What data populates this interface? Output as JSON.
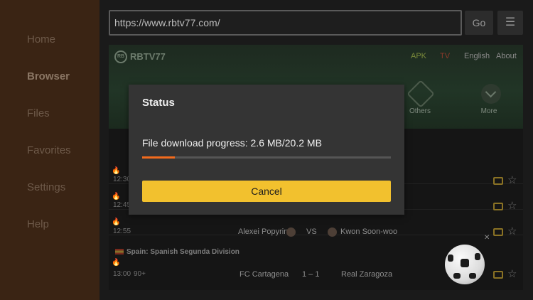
{
  "sidebar": {
    "items": [
      {
        "label": "Home",
        "active": false
      },
      {
        "label": "Browser",
        "active": true
      },
      {
        "label": "Files",
        "active": false
      },
      {
        "label": "Favorites",
        "active": false
      },
      {
        "label": "Settings",
        "active": false
      },
      {
        "label": "Help",
        "active": false
      }
    ]
  },
  "toolbar": {
    "url_value": "https://www.rbtv77.com/",
    "go_label": "Go",
    "menu_icon": "☰"
  },
  "website": {
    "logo_text": "RB",
    "title": "RBTV77",
    "top_links": {
      "apk": "APK",
      "tv": "TV",
      "language": "English",
      "about": "About"
    },
    "categories": [
      "Others",
      "More"
    ],
    "matches": [
      {
        "time": "12:30"
      },
      {
        "time": "12:45"
      },
      {
        "time": "12:55",
        "home": "Alexei Popyrin",
        "vs": "VS",
        "away": "Kwon Soon-woo"
      },
      {
        "league": "Spain: Spanish Segunda Division"
      },
      {
        "time": "13:00",
        "minute": "90+",
        "home": "FC Cartagena",
        "score": "1 – 1",
        "away": "Real Zaragoza"
      }
    ]
  },
  "dialog": {
    "title": "Status",
    "message": "File download progress: 2.6 MB/20.2 MB",
    "progress_fraction": 0.13,
    "cancel_label": "Cancel"
  },
  "colors": {
    "accent": "#f2c12e",
    "progress": "#f26b1d",
    "sidebar_bg": "#3a2414"
  }
}
